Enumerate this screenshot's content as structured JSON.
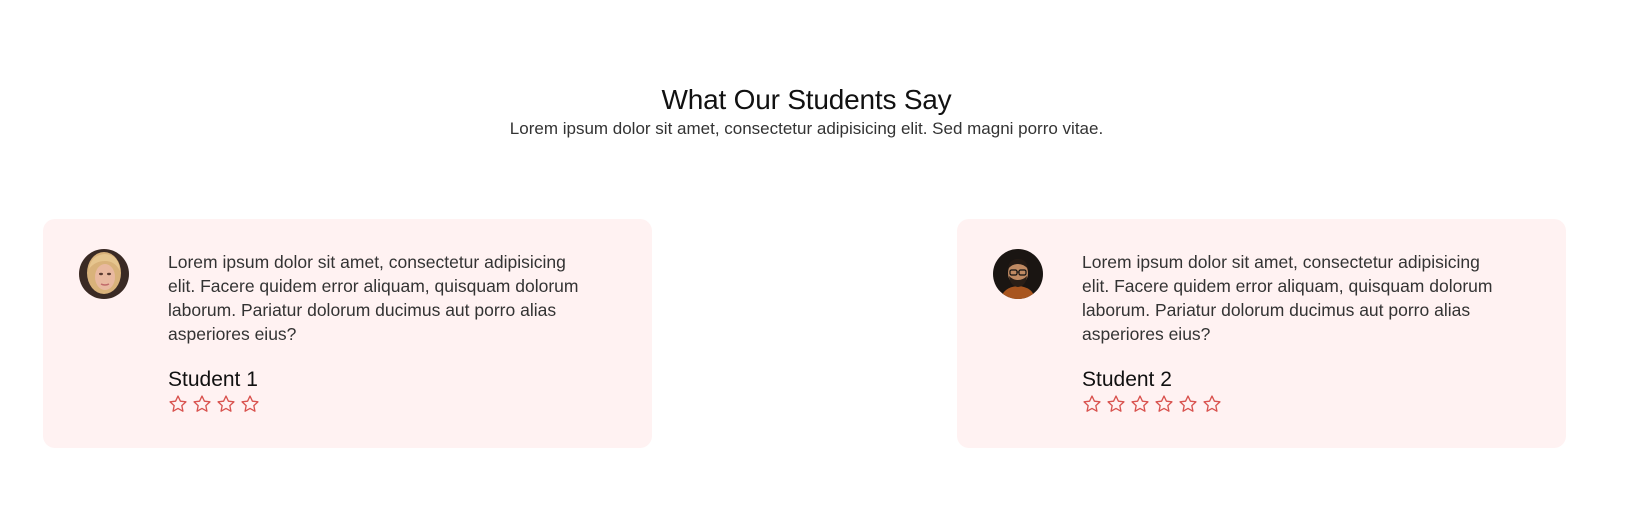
{
  "section": {
    "title": "What Our Students Say",
    "subtitle": "Lorem ipsum dolor sit amet, consectetur adipisicing elit. Sed magni porro vitae."
  },
  "testimonials": [
    {
      "quote": "Lorem ipsum dolor sit amet, consectetur adipisicing elit. Facere quidem error aliquam, quisquam dolorum laborum. Pariatur dolorum ducimus aut porro alias asperiores eius?",
      "name": "Student 1",
      "rating": 4,
      "avatar": "student-1-photo"
    },
    {
      "quote": "Lorem ipsum dolor sit amet, consectetur adipisicing elit. Facere quidem error aliquam, quisquam dolorum laborum. Pariatur dolorum ducimus aut porro alias asperiores eius?",
      "name": "Student 2",
      "rating": 6,
      "avatar": "student-2-photo"
    }
  ],
  "colors": {
    "card_background": "#fff2f2",
    "star_outline": "#d9534f"
  },
  "icons": {
    "star": "star-outline-icon"
  }
}
